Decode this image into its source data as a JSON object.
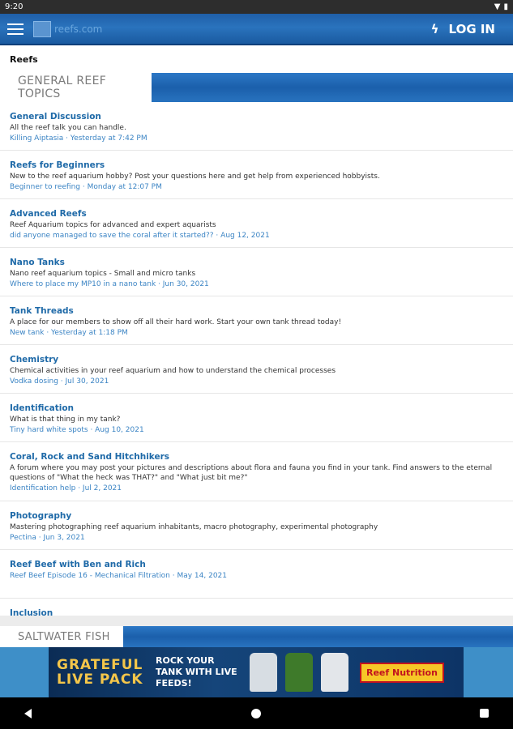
{
  "status_bar": {
    "time": "9:20",
    "battery": "▮"
  },
  "app_bar": {
    "logo_text": "reefs.com",
    "login_label": "LOG IN",
    "accent": "#2a73bd"
  },
  "breadcrumb": "Reefs",
  "sections": [
    {
      "title": "GENERAL REEF TOPICS",
      "forums": [
        {
          "title": "General Discussion",
          "desc": "All the reef talk you can handle.",
          "latest_thread": "Killing Aiptasia",
          "latest_date": "Yesterday at 7:42 PM"
        },
        {
          "title": "Reefs for Beginners",
          "desc": "New to the reef aquarium hobby?  Post your questions here and get help from experienced hobbyists.",
          "latest_thread": "Beginner to reefing",
          "latest_date": "Monday at 12:07 PM"
        },
        {
          "title": "Advanced Reefs",
          "desc": "Reef Aquarium topics for advanced and expert aquarists",
          "latest_thread": "did anyone managed to save the coral after it started??",
          "latest_date": "Aug 12, 2021"
        },
        {
          "title": "Nano Tanks",
          "desc": "Nano reef aquarium topics - Small and micro tanks",
          "latest_thread": "Where to place my MP10 in a nano tank",
          "latest_date": "Jun 30, 2021"
        },
        {
          "title": "Tank Threads",
          "desc": "A place for our members to show off all their hard work.  Start your own tank thread today!",
          "latest_thread": "New tank",
          "latest_date": "Yesterday at 1:18 PM"
        },
        {
          "title": "Chemistry",
          "desc": "Chemical activities in your reef aquarium and how to understand the chemical processes",
          "latest_thread": "Vodka dosing",
          "latest_date": "Jul 30, 2021"
        },
        {
          "title": "Identification",
          "desc": "What is that thing in my tank?",
          "latest_thread": "Tiny hard white spots",
          "latest_date": "Aug 10, 2021"
        },
        {
          "title": "Coral, Rock and Sand Hitchhikers",
          "desc": "A forum where you may post your pictures and descriptions about flora and fauna you find in your tank. Find answers to the eternal questions of \"What the heck was THAT?\" and \"What just bit me?\"",
          "latest_thread": "Identification help",
          "latest_date": "Jul 2, 2021"
        },
        {
          "title": "Photography",
          "desc": "Mastering photographing reef aquarium inhabitants, macro photography, experimental photography",
          "latest_thread": "Pectina",
          "latest_date": "Jun 3, 2021"
        },
        {
          "title": "Reef Beef with Ben and Rich",
          "desc": "",
          "latest_thread": "Reef Beef Episode 16 - Mechanical Filtration",
          "latest_date": "May 14, 2021"
        },
        {
          "title": "Inclusion",
          "desc": "",
          "latest_thread": "",
          "latest_date": ""
        }
      ]
    },
    {
      "title": "SALTWATER FISH"
    }
  ],
  "ad": {
    "headline": "GRATEFUL LIVE PACK",
    "tagline": "ROCK YOUR TANK WITH LIVE FEEDS!",
    "brand": "Reef Nutrition",
    "bottle_colors": [
      "#d7dde3",
      "#3e7a2a",
      "#e3e6ea"
    ]
  }
}
